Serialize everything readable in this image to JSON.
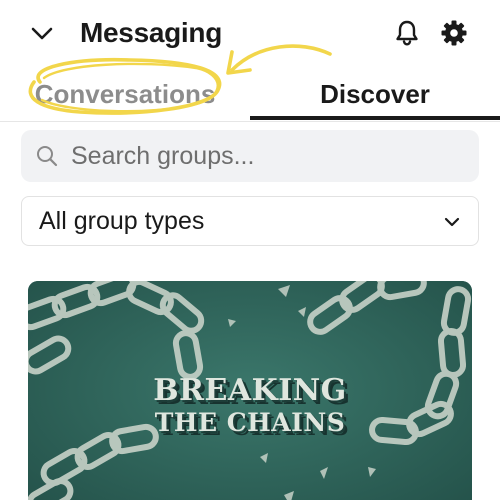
{
  "header": {
    "title": "Messaging",
    "collapse_icon": "chevron-down-icon",
    "notifications_icon": "bell-icon",
    "settings_icon": "gear-icon"
  },
  "tabs": [
    {
      "label": "Conversations",
      "active": false
    },
    {
      "label": "Discover",
      "active": true
    }
  ],
  "annotation": {
    "type": "hand-drawn-circle-and-arrow",
    "target": "Conversations",
    "color": "#f2d64b"
  },
  "search": {
    "placeholder": "Search groups...",
    "value": "",
    "icon": "search-icon"
  },
  "filter": {
    "selected": "All group types",
    "icon": "chevron-down-icon"
  },
  "group_card": {
    "title_line_1": "BREAKING",
    "title_line_2": "THE CHAINS",
    "background_color": "#2e6158"
  }
}
